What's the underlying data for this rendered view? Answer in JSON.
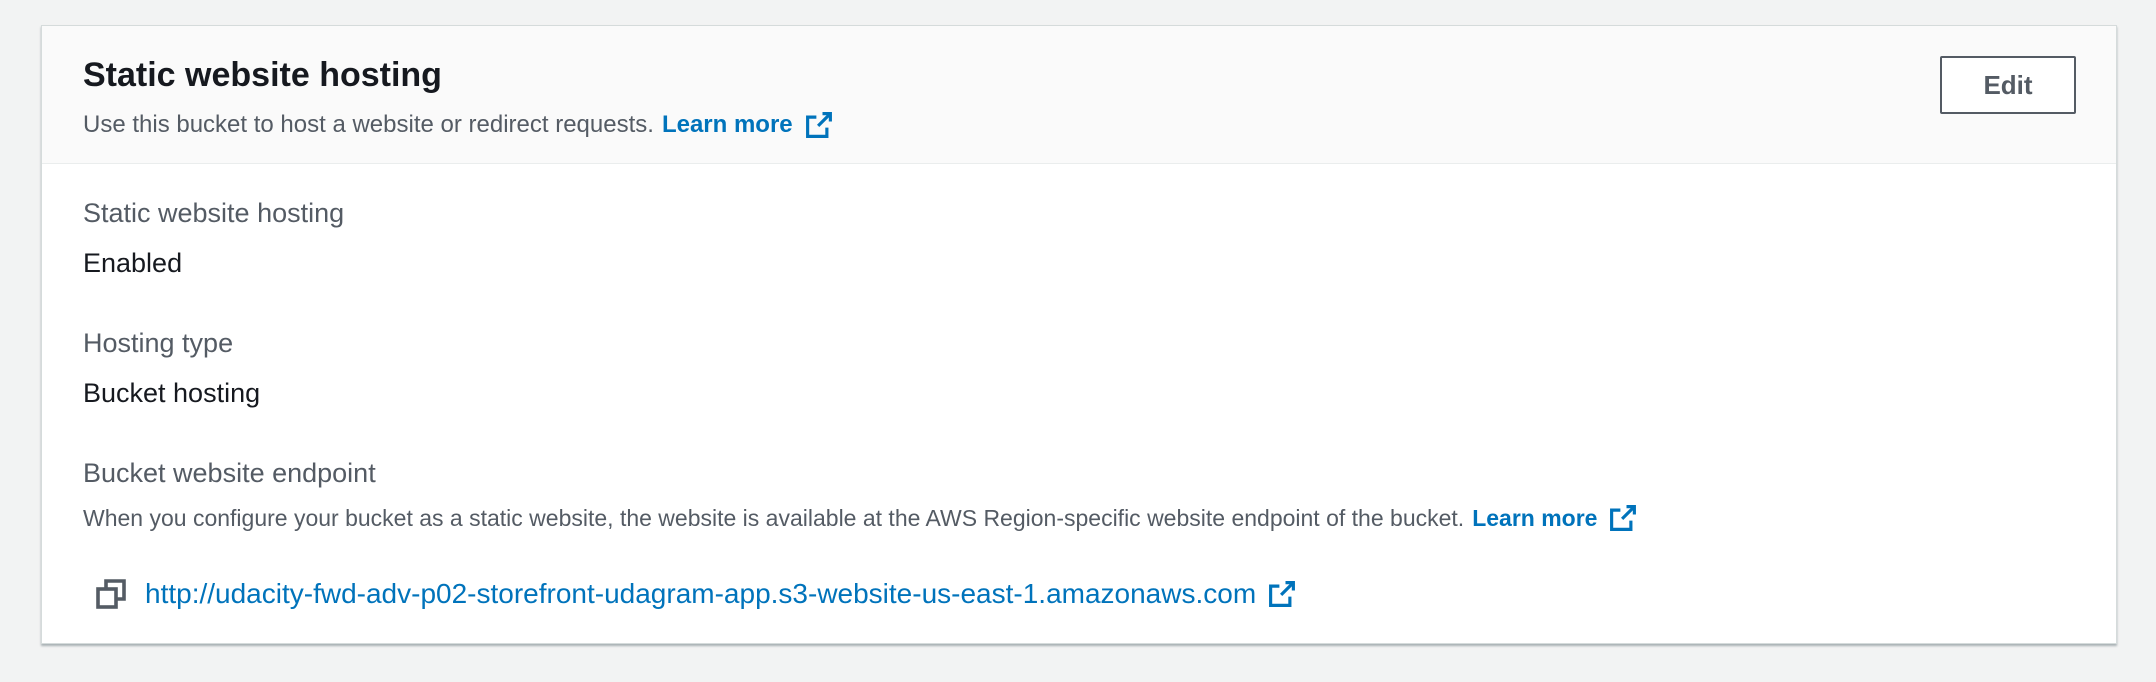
{
  "panel": {
    "title": "Static website hosting",
    "description": "Use this bucket to host a website or redirect requests.",
    "learn_more": "Learn more",
    "edit_label": "Edit"
  },
  "fields": {
    "static_hosting": {
      "label": "Static website hosting",
      "value": "Enabled"
    },
    "hosting_type": {
      "label": "Hosting type",
      "value": "Bucket hosting"
    },
    "endpoint": {
      "label": "Bucket website endpoint",
      "description": "When you configure your bucket as a static website, the website is available at the AWS Region-specific website endpoint of the bucket.",
      "learn_more": "Learn more",
      "url": "http://udacity-fwd-adv-p02-storefront-udagram-app.s3-website-us-east-1.amazonaws.com"
    }
  },
  "colors": {
    "link": "#0073bb",
    "text_primary": "#16191f",
    "text_secondary": "#545b64",
    "header_bg": "#fafafa",
    "page_bg": "#f2f3f3"
  },
  "icons": {
    "external": "external-link-icon",
    "copy": "copy-icon"
  }
}
